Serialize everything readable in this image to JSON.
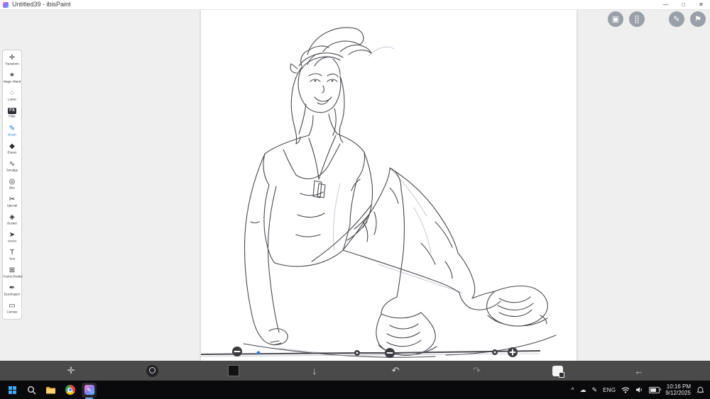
{
  "window": {
    "title": "Untitled39 - ibisPaint",
    "controls": {
      "minimize": "—",
      "maximize": "□",
      "close": "✕"
    }
  },
  "left_toolbar": {
    "items": [
      {
        "label": "Transform",
        "glyph": "✛"
      },
      {
        "label": "Magic Wand",
        "glyph": "✶"
      },
      {
        "label": "Lasso",
        "glyph": "◌"
      },
      {
        "label": "Filter",
        "glyph": "FX"
      },
      {
        "label": "Brush",
        "glyph": "✎",
        "active": true
      },
      {
        "label": "Eraser",
        "glyph": "◆"
      },
      {
        "label": "Smudge",
        "glyph": "∿"
      },
      {
        "label": "Blur",
        "glyph": "◎"
      },
      {
        "label": "Special",
        "glyph": "✂"
      },
      {
        "label": "Bucket",
        "glyph": "◈"
      },
      {
        "label": "Vector",
        "glyph": "➤"
      },
      {
        "label": "Text",
        "glyph": "T"
      },
      {
        "label": "Frame Divider",
        "glyph": "⊞"
      },
      {
        "label": "Eyedropper",
        "glyph": "✒"
      },
      {
        "label": "Canvas",
        "glyph": "▭"
      }
    ]
  },
  "top_right_buttons": [
    {
      "name": "material",
      "glyph": "▣"
    },
    {
      "name": "dot-grid",
      "glyph": "⣿"
    },
    {
      "name": "pen",
      "glyph": "✎"
    },
    {
      "name": "color-flag",
      "glyph": "⚑"
    }
  ],
  "bottom_toolbar": {
    "current_color": "#111111",
    "icons": {
      "move": "✛",
      "down": "↓",
      "undo": "↶",
      "redo": "↷",
      "back": "←"
    }
  },
  "taskbar": {
    "tray": {
      "chevron": "^",
      "cloud": "☁",
      "pen": "✎",
      "language": "ENG",
      "time": "10:16 PM",
      "date": "9/12/2025"
    }
  },
  "colors": {
    "accent_blue": "#1d6fe0",
    "bottom_bar_bg": "#4a4a4a",
    "taskbar_bg": "#0a0a0c"
  }
}
